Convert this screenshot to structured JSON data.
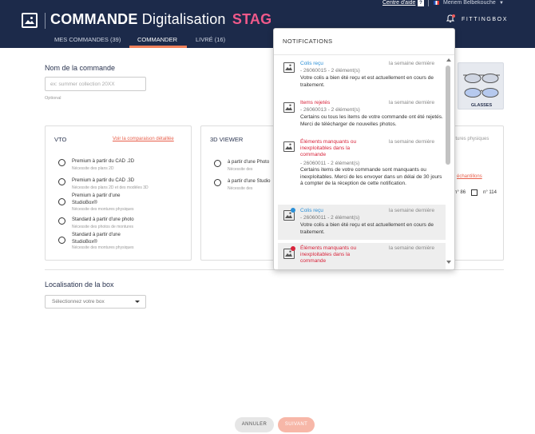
{
  "header": {
    "app_name": "COMMANDE",
    "app_subtitle": "Digitalisation",
    "env_badge": "STAG",
    "help_link": "Centre d'aide",
    "help_badge": "?",
    "user_name": "Meriem Belbekouche",
    "brand": "FITTINGBOX",
    "colors": {
      "background": "#1c2a4a",
      "env": "#f0598a",
      "active_tab": "#f0805a"
    }
  },
  "tabs": [
    {
      "label": "MES COMMANDES (39)",
      "active": false
    },
    {
      "label": "COMMANDER",
      "active": true
    },
    {
      "label": "LIVRÉ (16)",
      "active": false
    }
  ],
  "form": {
    "order_name_label": "Nom de la commande",
    "order_name_placeholder": "ex: summer collection 20XX",
    "optional": "Optional",
    "glasses_label": "GLASSES"
  },
  "vto": {
    "title": "VTO",
    "compare_link": "Voir la comparaison détaillée",
    "options": [
      {
        "title": "Premium à partir du CAD .2D",
        "sub": "Nécessite des plans 2D"
      },
      {
        "title": "Premium à partir du CAD .3D",
        "sub": "Nécessite des plans 2D et des modèles 3D"
      },
      {
        "title": "Premium à partir d'une",
        "title2": "StudioBox®",
        "sub": "Nécessite des montures physiques"
      },
      {
        "title": "Standard à partir d'une photo",
        "sub": "Nécessite des photos de montures"
      },
      {
        "title": "Standard à partir d'une",
        "title2": "StudioBox®",
        "sub": "Nécessite des montures physiques"
      }
    ]
  },
  "viewer3d": {
    "title": "3D VIEWER",
    "options": [
      {
        "title": "à partir d'une Photo",
        "sub": "Nécessite des"
      },
      {
        "title": "à partir d'une Studio",
        "sub": "Nécessite des"
      }
    ]
  },
  "right_card": {
    "sub_text": "ntures physiques",
    "link": "échantillons",
    "num_a": "n° 86",
    "num_b": "n° 114"
  },
  "location": {
    "label": "Localisation de la box",
    "select_placeholder": "Sélectionnez votre box"
  },
  "buttons": {
    "cancel": "ANNULER",
    "next": "SUIVANT"
  },
  "notifications": {
    "header": "NOTIFICATIONS",
    "items": [
      {
        "title": "Colis reçu",
        "color": "blue",
        "time": "la semaine dernière",
        "ref": "- 26060015 - 2 élément(s)",
        "body": "Votre colis a bien été reçu et est actuellement en cours de traitement.",
        "unread": false,
        "dot_color": ""
      },
      {
        "title": "Items rejetés",
        "color": "red",
        "time": "la semaine dernière",
        "ref": "- 26060013 - 2 élément(s)",
        "body": "Certains ou tous les items de votre commande ont été rejetés. Merci de télécharger de nouvelles photos.",
        "unread": false,
        "dot_color": ""
      },
      {
        "title": "Éléments manquants ou",
        "title2": "inexploitables dans la",
        "title3": "commande",
        "color": "red",
        "time": "la semaine dernière",
        "ref": "- 26060011 - 2 élément(s)",
        "body": "Certains items de votre commande sont manquants ou inexploitables. Merci de les envoyer dans un délai de 30 jours à compter de la réception de cette notification.",
        "unread": false,
        "dot_color": ""
      },
      {
        "title": "Colis reçu",
        "color": "blue",
        "time": "la semaine dernière",
        "ref": "- 26060011 - 2 élément(s)",
        "body": "Votre colis a bien été reçu et est actuellement en cours de traitement.",
        "unread": true,
        "dot_color": "#2a8fd6"
      },
      {
        "title": "Éléments manquants ou",
        "title2": "inexploitables dans la",
        "title3": "commande",
        "color": "red",
        "time": "la semaine dernière",
        "ref": "",
        "body": "",
        "unread": true,
        "dot_color": "#d8243b"
      }
    ]
  }
}
